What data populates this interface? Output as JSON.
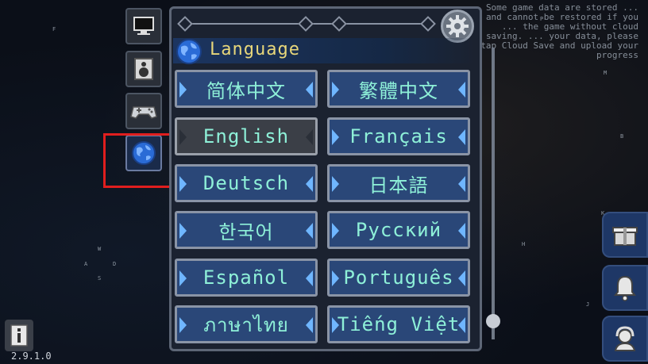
{
  "background": {
    "note": "Some game data are stored ... and cannot be restored if you ... the game without cloud saving. ... your data, please tap Cloud Save and upload your progress",
    "deco_letters": [
      "F",
      "P",
      "M",
      "B",
      "K",
      "H",
      "J",
      "W",
      "A",
      "D",
      "S"
    ]
  },
  "tabs": [
    {
      "name": "display",
      "icon": "monitor-icon"
    },
    {
      "name": "audio",
      "icon": "speaker-icon"
    },
    {
      "name": "controls",
      "icon": "gamepad-icon"
    },
    {
      "name": "language",
      "icon": "globe-icon",
      "active": true
    }
  ],
  "header": {
    "title": "Language",
    "icon": "globe-icon"
  },
  "settings_icon": "gear-icon",
  "languages": [
    {
      "label": "简体中文"
    },
    {
      "label": "繁體中文"
    },
    {
      "label": "English",
      "selected": true
    },
    {
      "label": "Français"
    },
    {
      "label": "Deutsch"
    },
    {
      "label": "日本語"
    },
    {
      "label": "한국어"
    },
    {
      "label": "Русский"
    },
    {
      "label": "Español"
    },
    {
      "label": "Português"
    },
    {
      "label": "ภาษาไทย"
    },
    {
      "label": "Tiếng Việt"
    }
  ],
  "right_buttons": [
    {
      "icon": "gift-box-icon"
    },
    {
      "icon": "bell-icon"
    },
    {
      "icon": "support-agent-icon"
    }
  ],
  "version": "2.9.1.0",
  "colors": {
    "accent_text": "#8ef0d8",
    "header_text": "#e8d77a",
    "button_bg": "#2a4778",
    "highlight": "#e01e1e"
  }
}
